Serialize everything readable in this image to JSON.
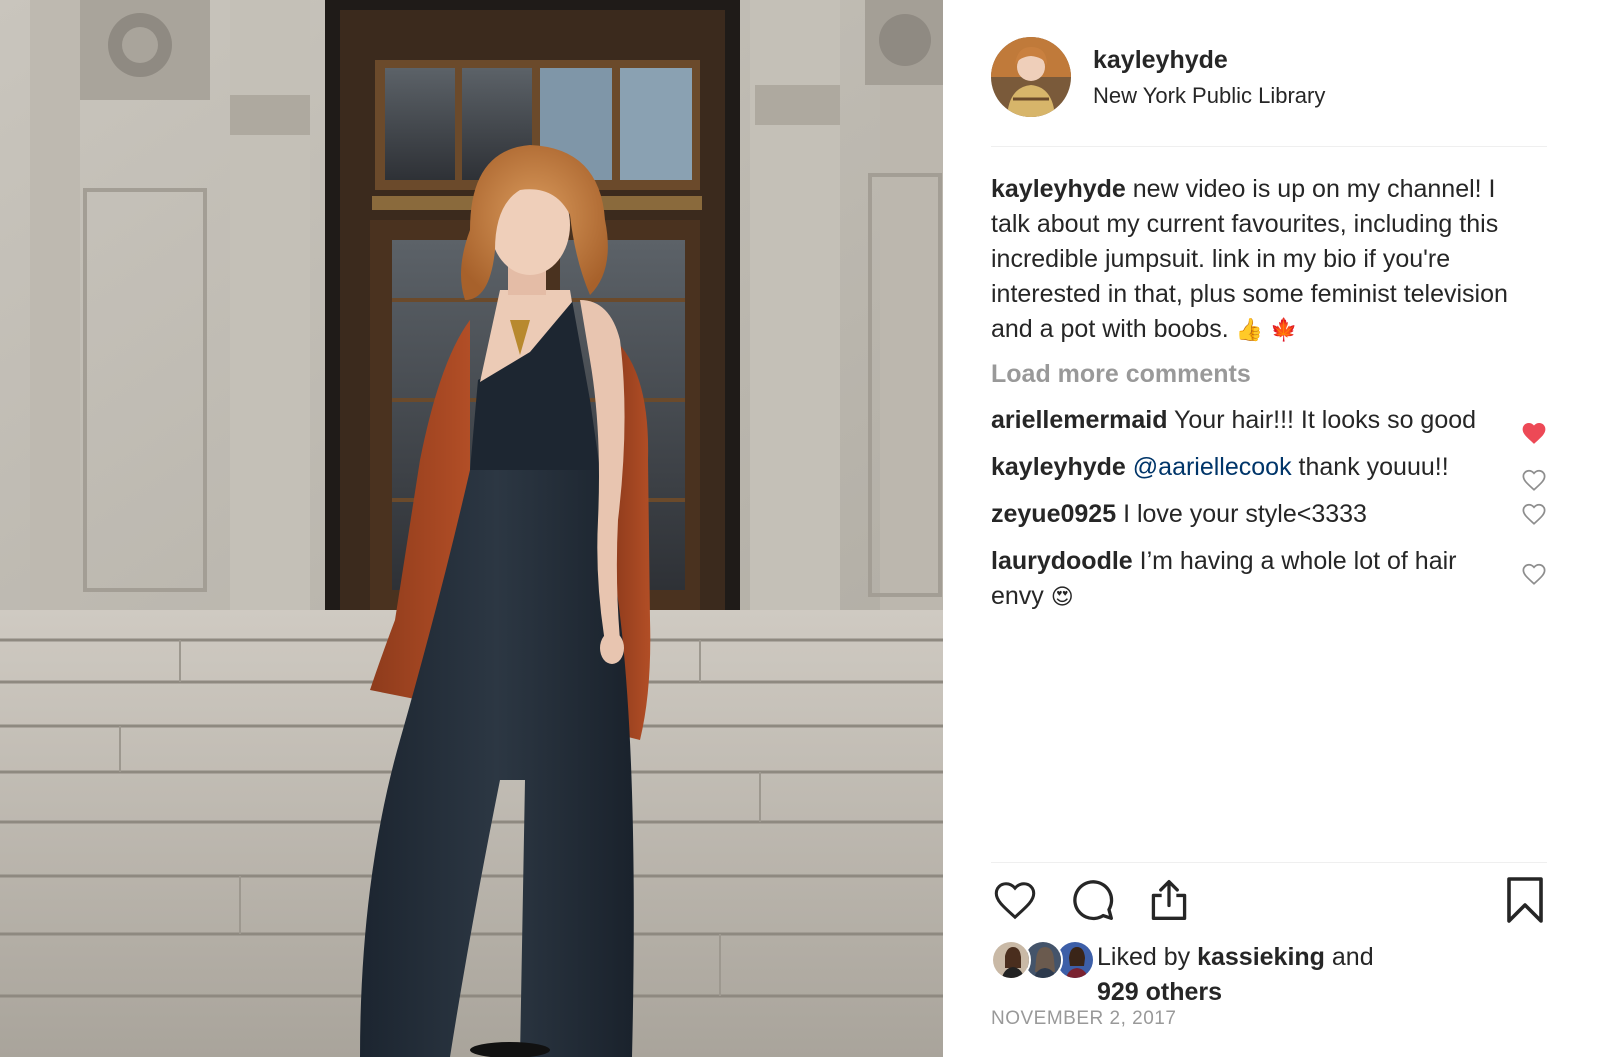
{
  "post": {
    "author": "kayleyhyde",
    "location": "New York Public Library",
    "date": "NOVEMBER 2, 2017"
  },
  "caption": {
    "username": "kayleyhyde",
    "text": "new video is up on my channel! I talk about my current favourites, including this incredible jumpsuit. link in my bio if you're interested in that, plus some feminist television and a pot with boobs.",
    "emoji_1": "👍",
    "emoji_2": "🍁"
  },
  "load_more_label": "Load more comments",
  "comments": [
    {
      "username": "ariellemermaid",
      "text": "Your hair!!! It looks so good",
      "liked": true
    },
    {
      "username": "kayleyhyde",
      "mention": "@aariellecook",
      "text": "thank youuu!!",
      "liked": false
    },
    {
      "username": "zeyue0925",
      "text": "I love your style<3333",
      "liked": false
    },
    {
      "username": "laurydoodle",
      "text": "I’m having a whole lot of hair envy",
      "emoji": "😍",
      "liked": false
    }
  ],
  "likes": {
    "prefix": "Liked by",
    "first_liker": "kassieking",
    "and": "and",
    "others": "929 others"
  },
  "icons": {
    "like": "heart-icon",
    "comment": "comment-bubble-icon",
    "share": "share-icon",
    "save": "bookmark-icon"
  },
  "colors": {
    "liked_heart": "#ed4956",
    "muted_text": "#999999",
    "mention": "#003569",
    "text": "#262626"
  }
}
